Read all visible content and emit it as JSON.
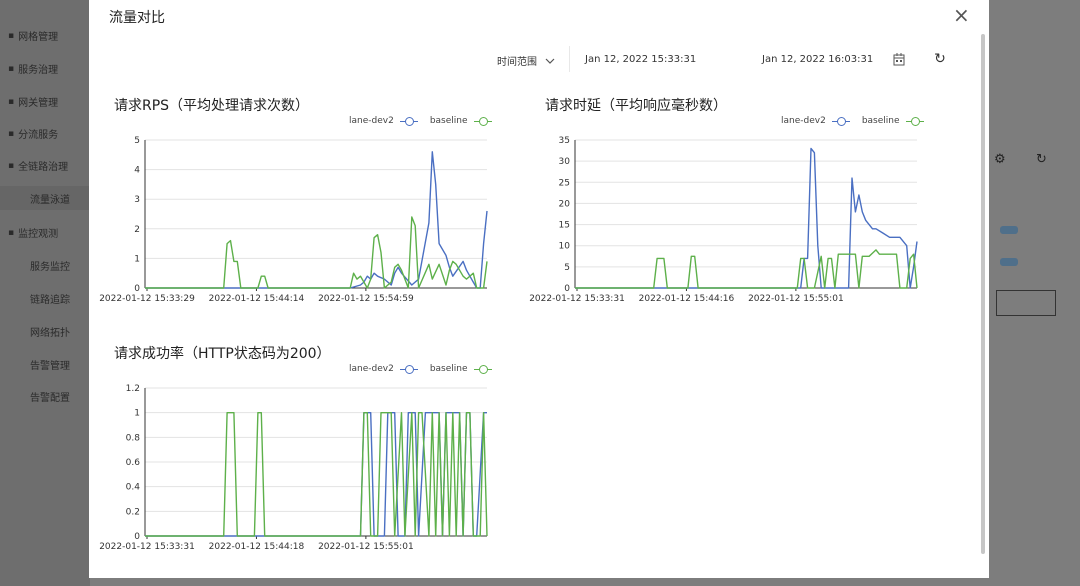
{
  "background": {
    "sidebar_items": [
      {
        "label": "网格管理",
        "icon": "grid-icon"
      },
      {
        "label": "服务治理",
        "icon": "service-icon"
      },
      {
        "label": "网关管理",
        "icon": "gateway-icon"
      },
      {
        "label": "分流服务",
        "icon": "share-icon"
      },
      {
        "label": "全链路治理",
        "icon": "network-icon"
      },
      {
        "label": "流量泳道",
        "icon": "",
        "sub": true,
        "active": true
      },
      {
        "label": "监控观测",
        "icon": "chart-icon"
      },
      {
        "label": "服务监控",
        "icon": "",
        "sub": true
      },
      {
        "label": "链路追踪",
        "icon": "",
        "sub": true
      },
      {
        "label": "网络拓扑",
        "icon": "",
        "sub": true
      },
      {
        "label": "告警管理",
        "icon": "",
        "sub": true
      },
      {
        "label": "告警配置",
        "icon": "",
        "sub": true
      }
    ]
  },
  "modal": {
    "title": "流量对比",
    "close_icon": "close-icon",
    "time_range_label": "时间范围",
    "range_start": "Jan 12, 2022 15:33:31",
    "range_end": "Jan 12, 2022 16:03:31",
    "calendar_icon": "calendar-icon",
    "refresh_icon": "refresh-icon"
  },
  "colors": {
    "lane-dev2": "#4a6fc2",
    "baseline": "#5db04a"
  },
  "chart_data": [
    {
      "type": "line",
      "title": "请求RPS（平均处理请求次数）",
      "series_names": [
        "lane-dev2",
        "baseline"
      ],
      "x_tick_labels": [
        "2022-01-12 15:33:29",
        "2022-01-12 15:44:14",
        "2022-01-12 15:54:59"
      ],
      "y_tick_labels": [
        "0",
        "1",
        "2",
        "3",
        "4",
        "5"
      ],
      "ylim": [
        0,
        5
      ],
      "grid": true,
      "legend": "top-right",
      "series": [
        {
          "name": "lane-dev2",
          "x": [
            0,
            60,
            63,
            64,
            65,
            66,
            67,
            68,
            70,
            72,
            73,
            74,
            75,
            78,
            80,
            83,
            84,
            85,
            86,
            88,
            89,
            90,
            93,
            94,
            95,
            96,
            97,
            98,
            99,
            100
          ],
          "y": [
            0,
            0,
            0.1,
            0.2,
            0.4,
            0.3,
            0.5,
            0.4,
            0.3,
            0.1,
            0.5,
            0.7,
            0.5,
            0.1,
            0.3,
            2.2,
            4.6,
            3.5,
            1.5,
            1.1,
            0.7,
            0.4,
            0.9,
            0.6,
            0.4,
            0.2,
            0,
            0,
            1.5,
            2.6
          ]
        },
        {
          "name": "baseline",
          "x": [
            0,
            23,
            24,
            25,
            26,
            27,
            28,
            33,
            34,
            35,
            36,
            60,
            61,
            62,
            63,
            64,
            65,
            66,
            67,
            68,
            69,
            70,
            72,
            73,
            74,
            75,
            77,
            78,
            79,
            80,
            83,
            84,
            86,
            88,
            89,
            90,
            91,
            92,
            93,
            94,
            96,
            97,
            99,
            100
          ],
          "y": [
            0,
            0,
            1.5,
            1.6,
            0.9,
            0.9,
            0,
            0,
            0.4,
            0.4,
            0,
            0,
            0.5,
            0.3,
            0.4,
            0.2,
            0,
            0.3,
            1.7,
            1.8,
            1.2,
            0,
            0.2,
            0.7,
            0.8,
            0.6,
            0,
            2.4,
            2.1,
            0,
            0.8,
            0.3,
            0.8,
            0.1,
            0.6,
            0.9,
            0.8,
            0.6,
            0.4,
            0.3,
            0.5,
            0,
            0,
            0.9
          ]
        }
      ]
    },
    {
      "type": "line",
      "title": "请求时延（平均响应毫秒数）",
      "series_names": [
        "lane-dev2",
        "baseline"
      ],
      "x_tick_labels": [
        "2022-01-12 15:33:31",
        "2022-01-12 15:44:16",
        "2022-01-12 15:55:01"
      ],
      "y_tick_labels": [
        "0",
        "5",
        "10",
        "15",
        "20",
        "25",
        "30",
        "35"
      ],
      "ylim": [
        0,
        35
      ],
      "grid": true,
      "legend": "top-right",
      "series": [
        {
          "name": "lane-dev2",
          "x": [
            0,
            66,
            67,
            68,
            69,
            70,
            71,
            72,
            73,
            74,
            75,
            76,
            80,
            81,
            82,
            83,
            84,
            85,
            86,
            87,
            88,
            90,
            92,
            95,
            97,
            98,
            99,
            100
          ],
          "y": [
            0,
            0,
            7,
            7,
            33,
            32,
            10,
            0,
            0,
            0,
            0,
            0,
            0,
            26,
            18,
            22,
            18,
            16,
            15,
            14,
            14,
            13,
            12,
            12,
            10,
            0,
            5,
            11
          ]
        },
        {
          "name": "baseline",
          "x": [
            0,
            23,
            24,
            26,
            27,
            33,
            34,
            35,
            36,
            65,
            66,
            67,
            68,
            70,
            72,
            73,
            74,
            75,
            76,
            77,
            78,
            82,
            83,
            84,
            85,
            86,
            88,
            89,
            90,
            94,
            95,
            96,
            97,
            98,
            99,
            100
          ],
          "y": [
            0,
            0,
            7,
            7,
            0,
            0,
            7.5,
            7.5,
            0,
            0,
            7,
            7,
            0,
            0,
            7.5,
            0,
            7,
            7,
            0,
            8,
            8,
            8,
            0,
            7.5,
            7.5,
            7.5,
            9,
            8,
            8,
            8,
            0,
            0,
            0,
            7,
            8,
            0
          ]
        }
      ]
    },
    {
      "type": "line",
      "title": "请求成功率（HTTP状态码为200）",
      "series_names": [
        "lane-dev2",
        "baseline"
      ],
      "x_tick_labels": [
        "2022-01-12 15:33:31",
        "2022-01-12 15:44:18",
        "2022-01-12 15:55:01"
      ],
      "y_tick_labels": [
        "0",
        "0.2",
        "0.4",
        "0.6",
        "0.8",
        "1",
        "1.2"
      ],
      "ylim": [
        0,
        1.2
      ],
      "grid": true,
      "legend": "top-right",
      "series": [
        {
          "name": "lane-dev2",
          "x": [
            0,
            63,
            64,
            66,
            67,
            70,
            71,
            73,
            74,
            76,
            77,
            79,
            80,
            82,
            83,
            86,
            87,
            88,
            89,
            92,
            93,
            94,
            95,
            96,
            97,
            99,
            100
          ],
          "y": [
            0,
            0,
            1,
            1,
            0,
            0,
            1,
            1,
            0,
            0,
            1,
            1,
            0,
            1,
            1,
            1,
            0,
            1,
            1,
            1,
            0,
            1,
            1,
            0,
            0,
            1,
            1
          ]
        },
        {
          "name": "baseline",
          "x": [
            0,
            23,
            24,
            26,
            27,
            32,
            33,
            34,
            35,
            63,
            64,
            65,
            66,
            68,
            69,
            72,
            73,
            75,
            76,
            78,
            79,
            80,
            81,
            83,
            84,
            85,
            86,
            87,
            88,
            89,
            90,
            91,
            92,
            93,
            94,
            95,
            96,
            98,
            99,
            100
          ],
          "y": [
            0,
            0,
            1,
            1,
            0,
            0,
            1,
            1,
            0,
            0,
            1,
            1,
            0,
            0,
            1,
            1,
            0,
            1,
            0,
            1,
            0,
            1,
            1,
            0,
            1,
            0,
            1,
            0,
            1,
            0,
            1,
            0,
            1,
            0,
            1,
            1,
            0,
            0,
            1,
            0
          ]
        }
      ]
    }
  ]
}
